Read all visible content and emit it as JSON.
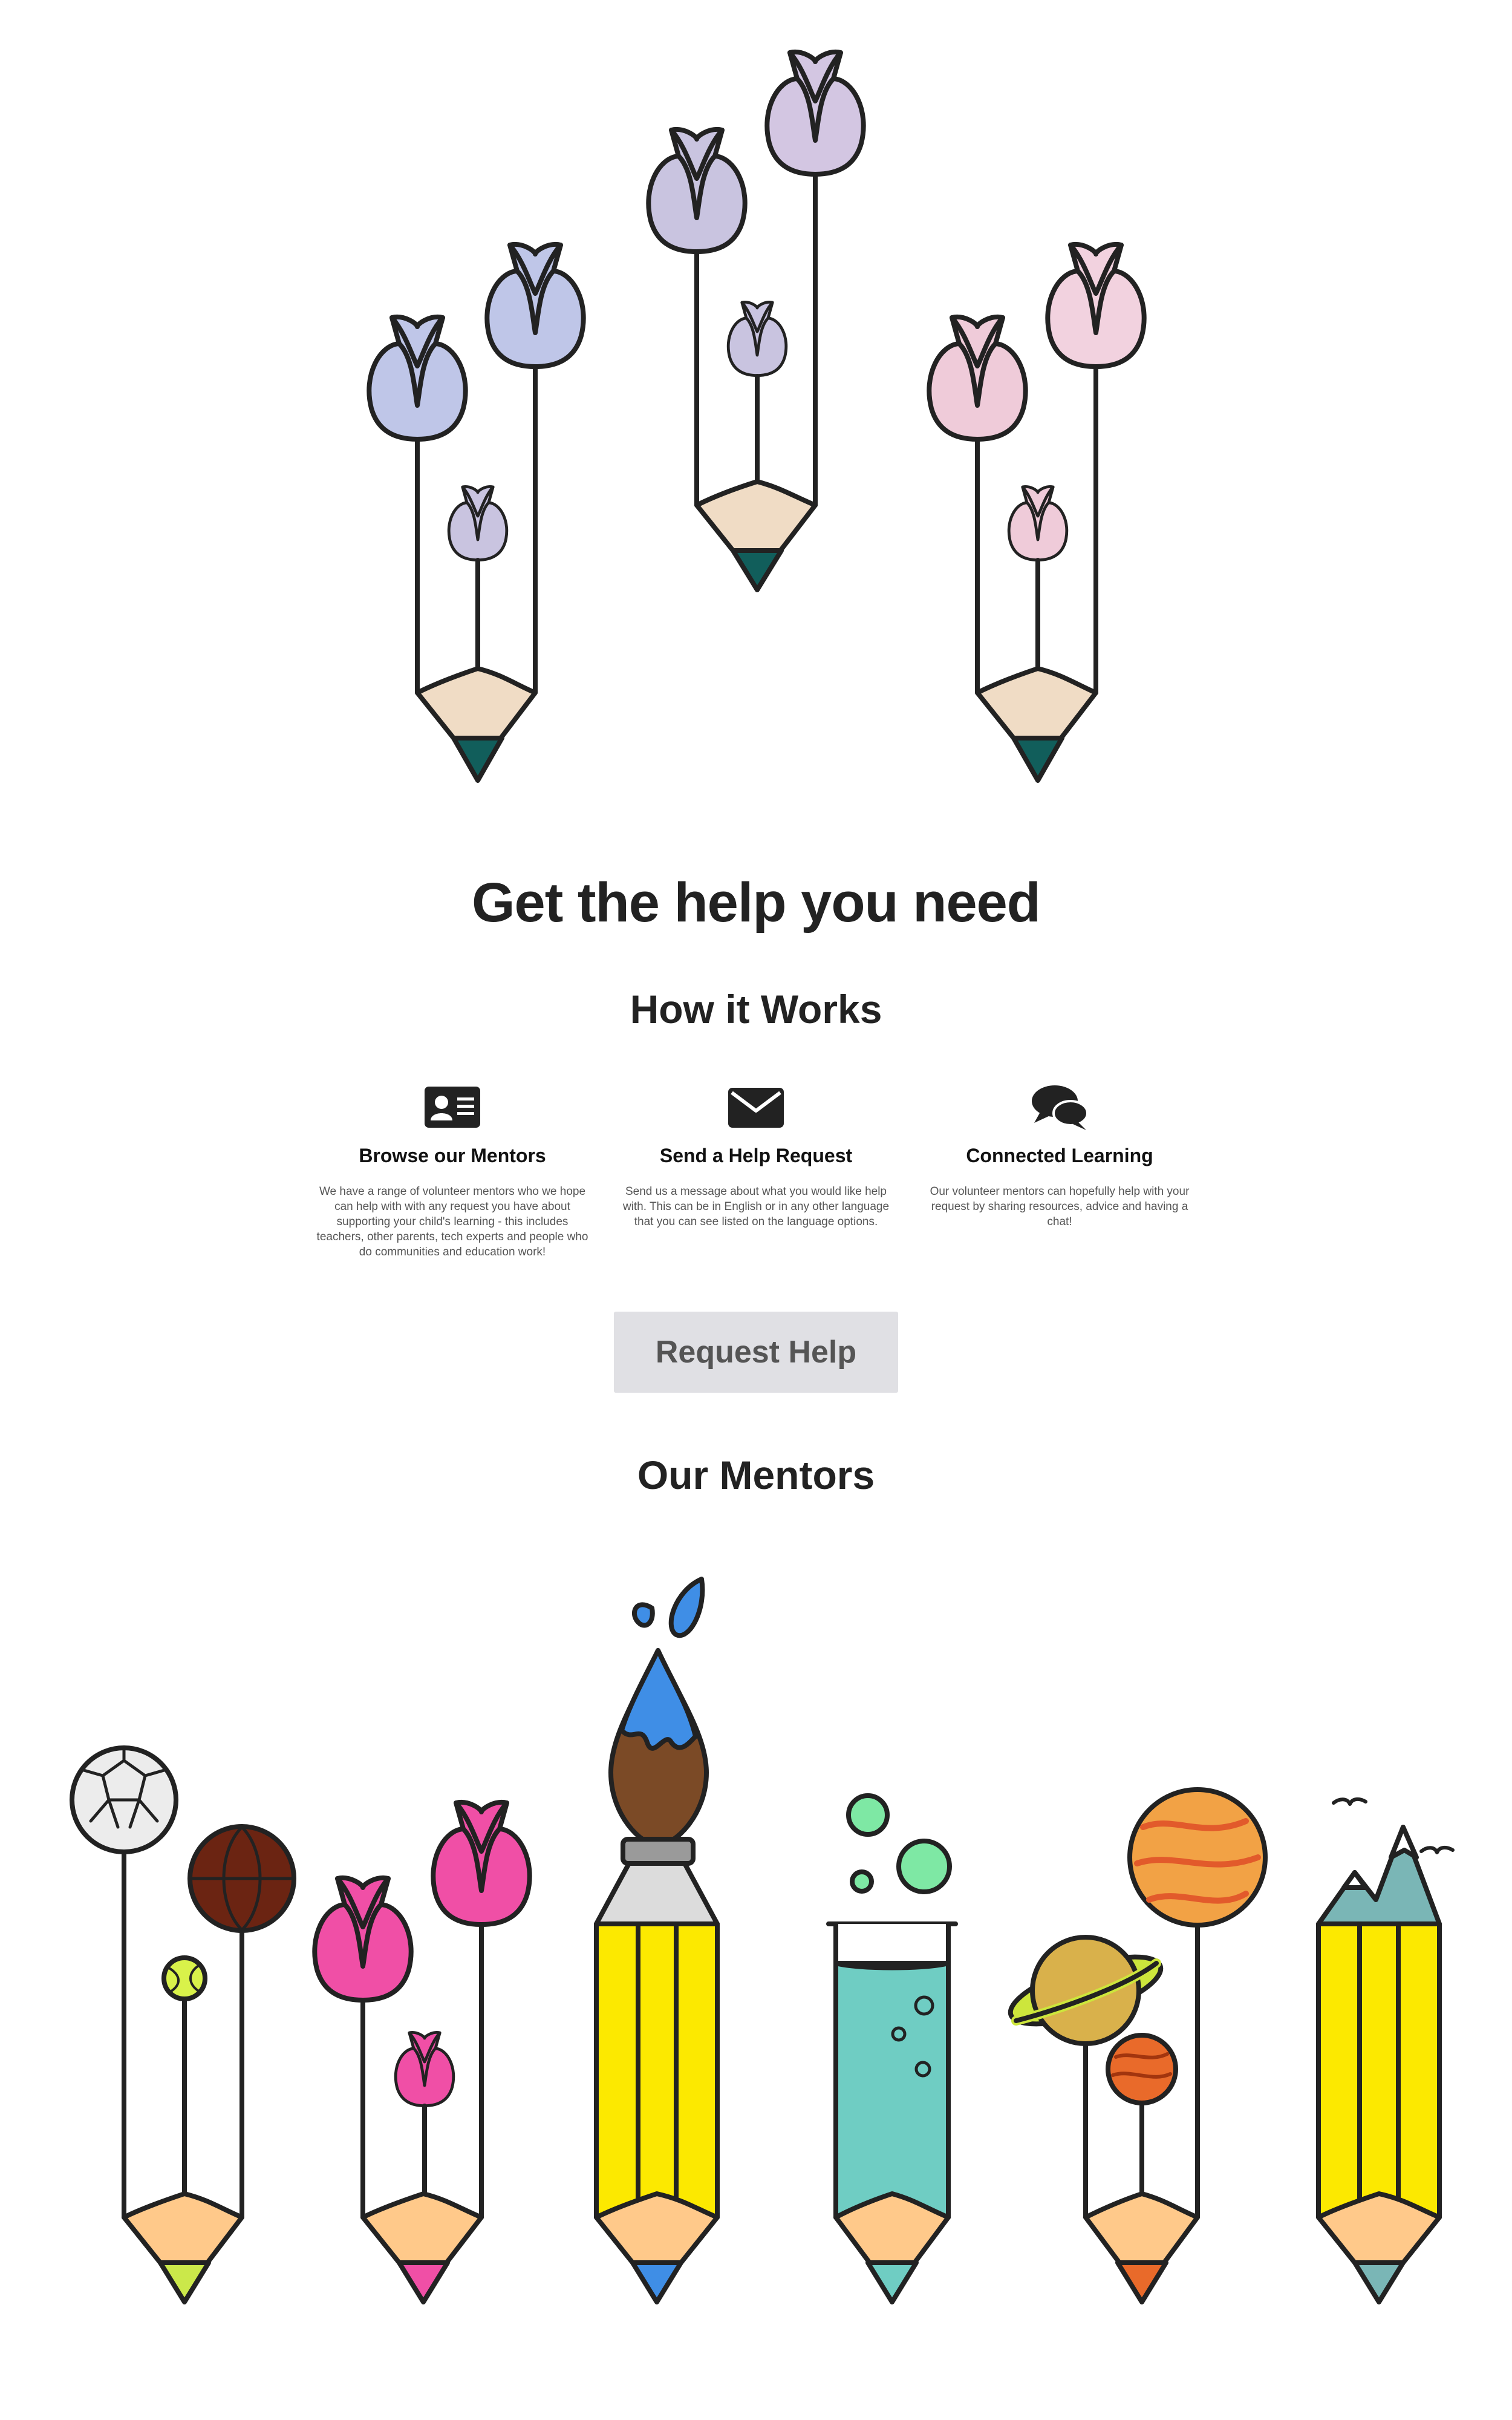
{
  "hero": {
    "title": "Get the help you need"
  },
  "how_it_works": {
    "title": "How it Works",
    "features": [
      {
        "icon": "id-card-icon",
        "title": "Browse our Mentors",
        "text": "We have a range of volunteer mentors who we hope can help with with any request you have about supporting your child's learning - this includes teachers, other parents, tech experts and people who do communities and education work!"
      },
      {
        "icon": "envelope-icon",
        "title": "Send a Help Request",
        "text": "Send us a message about what you would like help with. This can be in English or in any other language that you can see listed on the language options."
      },
      {
        "icon": "chat-bubbles-icon",
        "title": "Connected Learning",
        "text": "Our volunteer mentors can hopefully help with your request by sharing resources, advice and having a chat!"
      }
    ]
  },
  "cta": {
    "label": "Request Help"
  },
  "mentors": {
    "title": "Our Mentors"
  },
  "colors": {
    "text": "#222222",
    "button_bg": "#e0e0e4",
    "button_text": "#555555",
    "pencil_wood": "#f0dcc5",
    "pencil_tip": "#115e5b",
    "lavender": "#c9c4e0",
    "periwinkle": "#bfc6e8",
    "blush": "#efcbd9",
    "magenta": "#f04fa6",
    "yellow": "#fce900",
    "aqua": "#6fcdc3"
  }
}
